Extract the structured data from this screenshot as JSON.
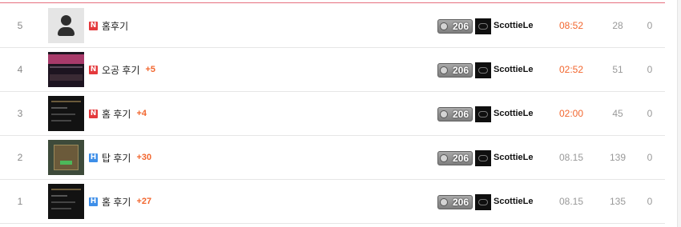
{
  "rows": [
    {
      "num": "5",
      "thumb": "profile",
      "icon": "N",
      "icon_color": "#e4393c",
      "title": "홈후기",
      "comments": "",
      "level": "206",
      "nick": "ScottieLe",
      "time": "08:52",
      "time_style": "today",
      "views": "28",
      "votes": "0"
    },
    {
      "num": "4",
      "thumb": "shot-pink",
      "icon": "N",
      "icon_color": "#e4393c",
      "title": "오공 후기",
      "comments": "+5",
      "level": "206",
      "nick": "ScottieLe",
      "time": "02:52",
      "time_style": "today",
      "views": "51",
      "votes": "0"
    },
    {
      "num": "3",
      "thumb": "shot-dark",
      "icon": "N",
      "icon_color": "#e4393c",
      "title": "홈 후기",
      "comments": "+4",
      "level": "206",
      "nick": "ScottieLe",
      "time": "02:00",
      "time_style": "today",
      "views": "45",
      "votes": "0"
    },
    {
      "num": "2",
      "thumb": "shot-game",
      "icon": "H",
      "icon_color": "#3d8ee8",
      "title": "탑 후기",
      "comments": "+30",
      "level": "206",
      "nick": "ScottieLe",
      "time": "08.15",
      "time_style": "past",
      "views": "139",
      "votes": "0"
    },
    {
      "num": "1",
      "thumb": "shot-dark",
      "icon": "H",
      "icon_color": "#3d8ee8",
      "title": "홈 후기",
      "comments": "+27",
      "level": "206",
      "nick": "ScottieLe",
      "time": "08.15",
      "time_style": "past",
      "views": "135",
      "votes": "0"
    }
  ]
}
